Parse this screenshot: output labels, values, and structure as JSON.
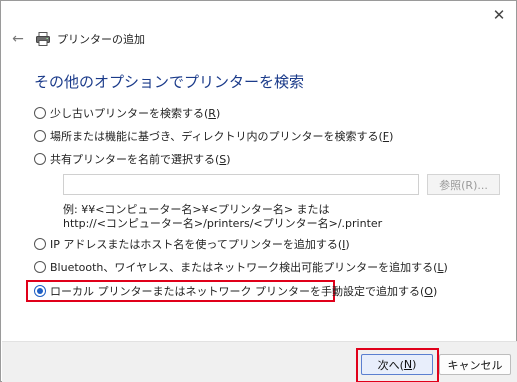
{
  "window": {
    "header_title": "プリンターの追加",
    "close_symbol": "✕",
    "back_symbol": "←"
  },
  "page": {
    "title": "その他のオプションでプリンターを検索"
  },
  "options": [
    {
      "label": "少し古いプリンターを検索する(",
      "key": "R",
      "suffix": ")",
      "checked": false
    },
    {
      "label": "場所または機能に基づき、ディレクトリ内のプリンターを検索する(",
      "key": "F",
      "suffix": ")",
      "checked": false
    },
    {
      "label": "共有プリンターを名前で選択する(",
      "key": "S",
      "suffix": ")",
      "checked": false
    },
    {
      "label": "IP アドレスまたはホスト名を使ってプリンターを追加する(",
      "key": "I",
      "suffix": ")",
      "checked": false
    },
    {
      "label": "Bluetooth、ワイヤレス、またはネットワーク検出可能プリンターを追加する(",
      "key": "L",
      "suffix": ")",
      "checked": false
    },
    {
      "label": "ローカル プリンターまたはネットワーク プリンターを手動設定で追加する(",
      "key": "O",
      "suffix": ")",
      "checked": true
    }
  ],
  "shared": {
    "input_value": "",
    "browse_label": "参照(R)...",
    "example_line1": "例: ¥¥<コンピューター名>¥<プリンター名> または",
    "example_line2": "http://<コンピューター名>/printers/<プリンター名>/.printer"
  },
  "footer": {
    "next_label": "次へ(",
    "next_key": "N",
    "next_suffix": ")",
    "cancel_label": "キャンセル"
  },
  "colors": {
    "title": "#1b3b8a",
    "accent": "#1f5fc4",
    "highlight": "#e0001a"
  }
}
